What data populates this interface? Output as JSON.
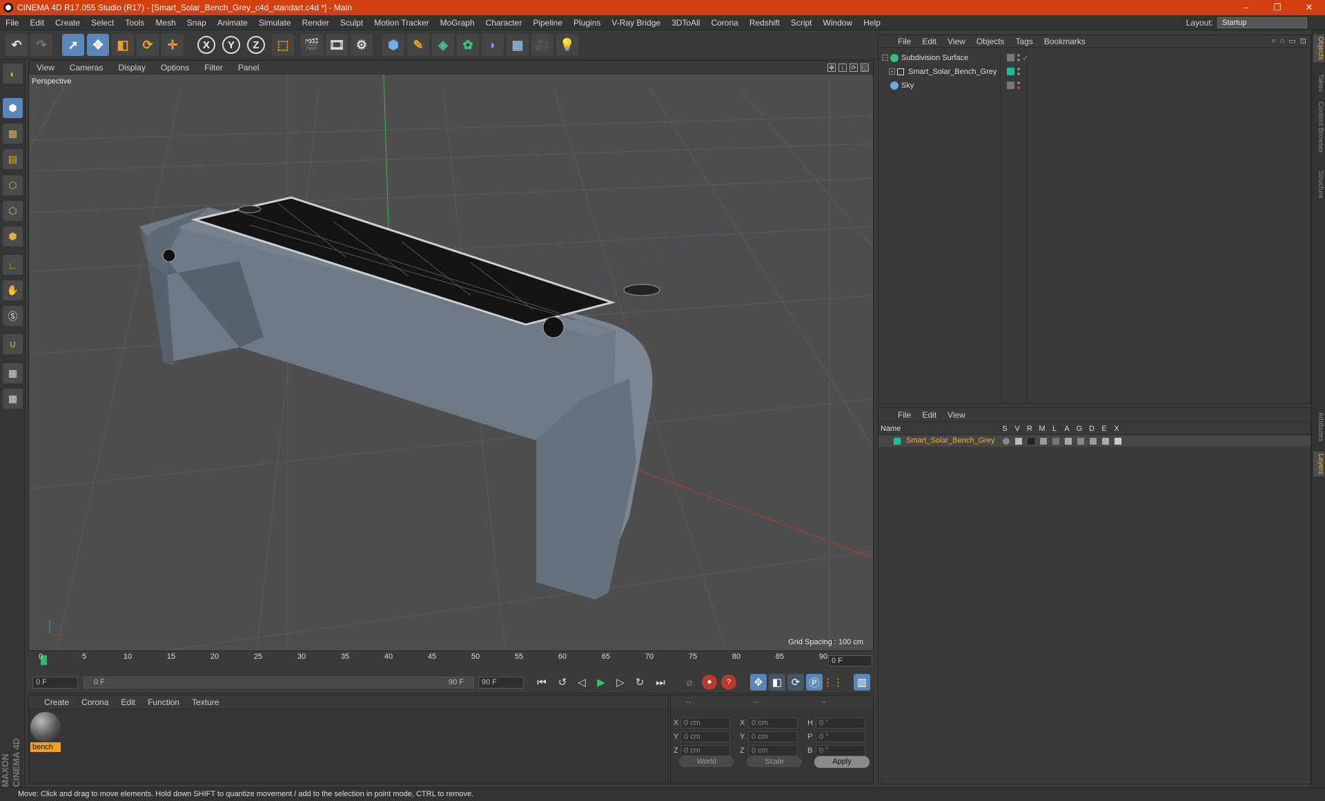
{
  "window": {
    "title": "CINEMA 4D R17.055 Studio (R17) - [Smart_Solar_Bench_Grey_c4d_standart.c4d *] - Main",
    "minimize": "–",
    "maximize": "❐",
    "close": "✕"
  },
  "menubar": {
    "items": [
      "File",
      "Edit",
      "Create",
      "Select",
      "Tools",
      "Mesh",
      "Snap",
      "Animate",
      "Simulate",
      "Render",
      "Sculpt",
      "Motion Tracker",
      "MoGraph",
      "Character",
      "Pipeline",
      "Plugins",
      "V-Ray Bridge",
      "3DToAll",
      "Corona",
      "Redshift",
      "Script",
      "Window",
      "Help"
    ],
    "layout_label": "Layout:",
    "layout_value": "Startup"
  },
  "toolbar": {
    "axis_x": "X",
    "axis_y": "Y",
    "axis_z": "Z"
  },
  "viewport": {
    "menu": [
      "View",
      "Cameras",
      "Display",
      "Options",
      "Filter",
      "Panel"
    ],
    "label": "Perspective",
    "grid_spacing": "Grid Spacing : 100 cm"
  },
  "timeline": {
    "ticks": [
      "0",
      "5",
      "10",
      "15",
      "20",
      "25",
      "30",
      "35",
      "40",
      "45",
      "50",
      "55",
      "60",
      "65",
      "70",
      "75",
      "80",
      "85",
      "90"
    ],
    "current_frame": "0 F"
  },
  "transport": {
    "start_field": "0 F",
    "range_start": "0 F",
    "range_end": "90 F",
    "end_field": "90 F"
  },
  "material_panel": {
    "menu": [
      "Create",
      "Corona",
      "Edit",
      "Function",
      "Texture"
    ],
    "materials": [
      {
        "name": "bench"
      }
    ]
  },
  "coordinates": {
    "headers": [
      "--",
      "--",
      "--"
    ],
    "rows": [
      {
        "a1": "X",
        "v1": "0 cm",
        "a2": "X",
        "v2": "0 cm",
        "a3": "H",
        "v3": "0 °"
      },
      {
        "a1": "Y",
        "v1": "0 cm",
        "a2": "Y",
        "v2": "0 cm",
        "a3": "P",
        "v3": "0 °"
      },
      {
        "a1": "Z",
        "v1": "0 cm",
        "a2": "Z",
        "v2": "0 cm",
        "a3": "B",
        "v3": "0 °"
      }
    ],
    "world": "World",
    "scale": "Scale",
    "apply": "Apply"
  },
  "object_manager": {
    "menu": [
      "File",
      "Edit",
      "View",
      "Objects",
      "Tags",
      "Bookmarks"
    ],
    "objects": [
      {
        "name": "Subdivision Surface",
        "icon_color": "#2ec27e"
      },
      {
        "name": "Smart_Solar_Bench_Grey",
        "icon_color": "#e0e0e0"
      },
      {
        "name": "Sky",
        "icon_color": "#6fa8dc"
      }
    ]
  },
  "layer_manager": {
    "menu": [
      "File",
      "Edit",
      "View"
    ],
    "header_name": "Name",
    "columns": [
      "S",
      "V",
      "R",
      "M",
      "L",
      "A",
      "G",
      "D",
      "E",
      "X"
    ],
    "layers": [
      {
        "name": "Smart_Solar_Bench_Grey",
        "color": "#17c09a"
      }
    ]
  },
  "right_tabs": [
    "Objects",
    "Takes",
    "Content Browser",
    "Structure",
    "Attributes",
    "Layers"
  ],
  "status": "Move: Click and drag to move elements. Hold down SHIFT to quantize movement / add to the selection in point mode, CTRL to remove.",
  "logo": "MAXON CINEMA 4D",
  "colors": {
    "accent": "#d2400f",
    "selection": "#5a86b8",
    "layer": "#17c09a",
    "material_label": "#f5a020"
  }
}
